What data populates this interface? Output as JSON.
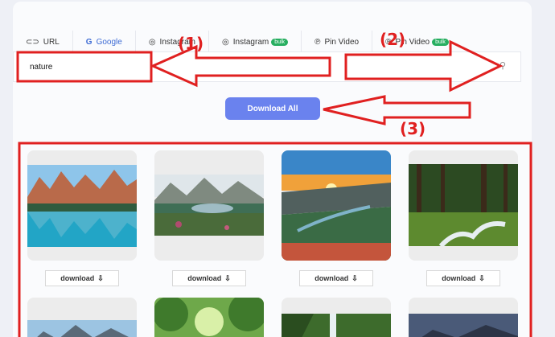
{
  "tabs": [
    {
      "label": "URL",
      "icon": "link-icon"
    },
    {
      "label": "Google",
      "icon": "google-icon"
    },
    {
      "label": "Instagram",
      "icon": "instagram-icon"
    },
    {
      "label": "Instagram",
      "icon": "instagram-icon",
      "badge": "bulk"
    },
    {
      "label": "Pin Video",
      "icon": "pinterest-icon"
    },
    {
      "label": "Pin Video",
      "icon": "pinterest-icon",
      "badge": "bulk"
    }
  ],
  "search": {
    "value": "nature"
  },
  "download_all_label": "Download All",
  "cards": [
    {
      "download_label": "download"
    },
    {
      "download_label": "download"
    },
    {
      "download_label": "download"
    },
    {
      "download_label": "download"
    }
  ],
  "annotations": [
    "(1)",
    "(2)",
    "(3)"
  ],
  "colors": {
    "accent": "#6a82ee",
    "active_tab": "#3d6bd4",
    "annotation": "#e02020",
    "badge": "#27ae60"
  }
}
